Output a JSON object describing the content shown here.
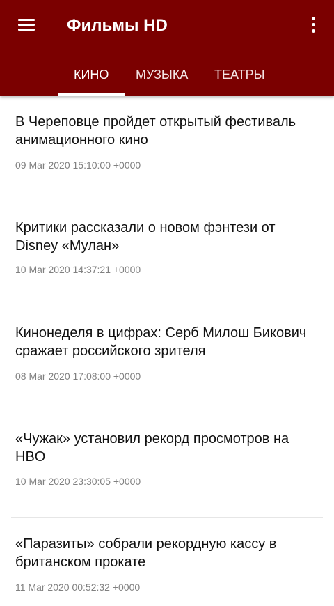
{
  "appbar": {
    "title": "Фильмы HD",
    "menu_icon": "hamburger-menu-icon",
    "overflow_icon": "more-vert-icon",
    "color": "#7b0000"
  },
  "tabs": [
    {
      "label": "КИНО",
      "active": true
    },
    {
      "label": "МУЗЫКА",
      "active": false
    },
    {
      "label": "ТЕАТРЫ",
      "active": false
    }
  ],
  "news": [
    {
      "title": "В Череповце пройдет открытый фестиваль анимационного кино",
      "date": "09 Mar 2020 15:10:00 +0000"
    },
    {
      "title": "Критики рассказали о новом фэнтези от Disney «Мулан»",
      "date": "10 Mar 2020 14:37:21 +0000"
    },
    {
      "title": "Кинонеделя в цифрах: Серб Милош Бикович сражает российского зрителя",
      "date": "08 Mar 2020 17:08:00 +0000"
    },
    {
      "title": "«Чужак» установил рекорд просмотров на HBO",
      "date": "10 Mar 2020 23:30:05 +0000"
    },
    {
      "title": "«Паразиты» собрали рекордную кассу в британском прокате",
      "date": "11 Mar 2020 00:52:32 +0000"
    }
  ]
}
